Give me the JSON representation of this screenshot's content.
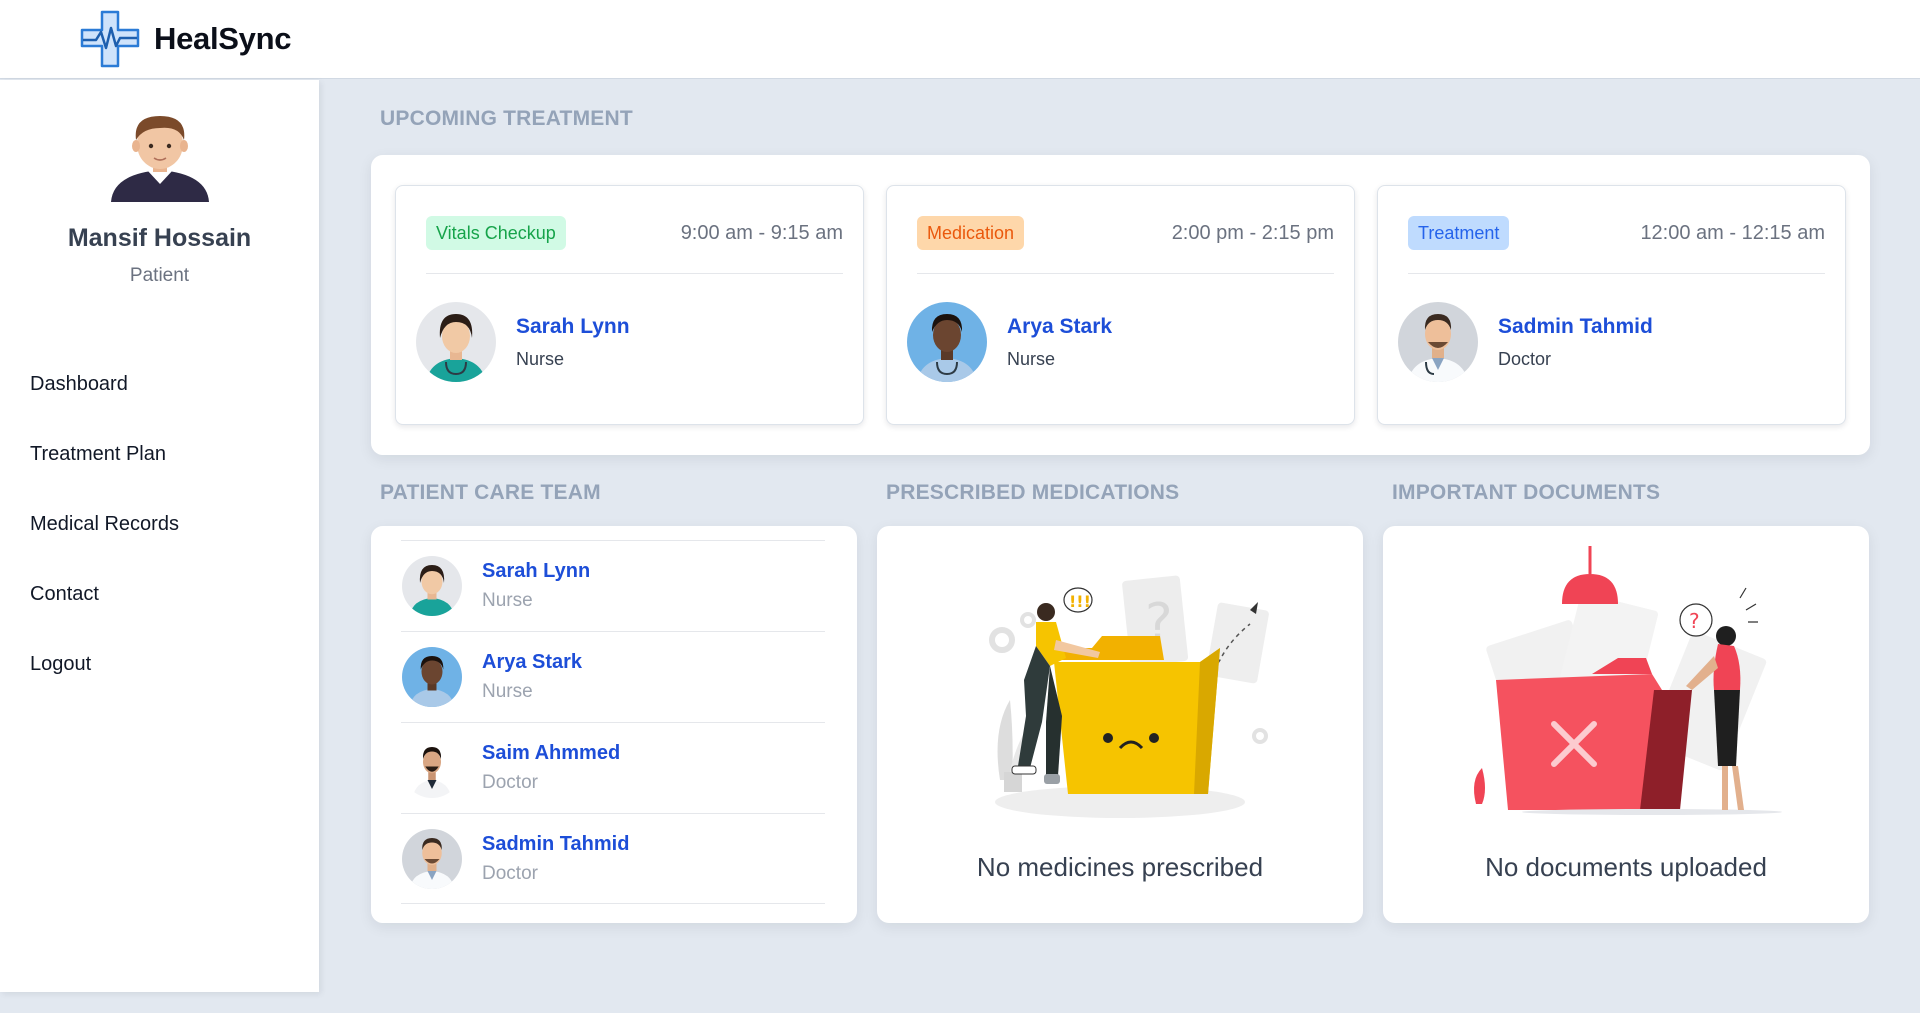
{
  "app": {
    "name": "HealSync"
  },
  "profile": {
    "name": "Mansif Hossain",
    "role": "Patient"
  },
  "nav": [
    {
      "label": "Dashboard"
    },
    {
      "label": "Treatment Plan"
    },
    {
      "label": "Medical Records"
    },
    {
      "label": "Contact"
    },
    {
      "label": "Logout"
    }
  ],
  "sections": {
    "upcoming": "UPCOMING TREATMENT",
    "team": "PATIENT CARE TEAM",
    "medications": "PRESCRIBED MEDICATIONS",
    "documents": "IMPORTANT DOCUMENTS"
  },
  "treatments": [
    {
      "tag": "Vitals Checkup",
      "tag_color": "#16a34a",
      "time": "9:00 am - 9:15 am",
      "name": "Sarah Lynn",
      "role": "Nurse"
    },
    {
      "tag": "Medication",
      "tag_color": "#ea580c",
      "time": "2:00 pm - 2:15 pm",
      "name": "Arya Stark",
      "role": "Nurse"
    },
    {
      "tag": "Treatment",
      "tag_color": "#2563eb",
      "time": "12:00 am - 12:15 am",
      "name": "Sadmin Tahmid",
      "role": "Doctor"
    }
  ],
  "team": [
    {
      "name": "Sarah Lynn",
      "role": "Nurse"
    },
    {
      "name": "Arya Stark",
      "role": "Nurse"
    },
    {
      "name": "Saim Ahmmed",
      "role": "Doctor"
    },
    {
      "name": "Sadmin Tahmid",
      "role": "Doctor"
    }
  ],
  "medications": {
    "empty_text": "No medicines prescribed"
  },
  "documents": {
    "empty_text": "No documents uploaded"
  },
  "colors": {
    "accent": "#1d4ed8",
    "background": "#e2e8f0",
    "section_title": "#94a3b8"
  }
}
